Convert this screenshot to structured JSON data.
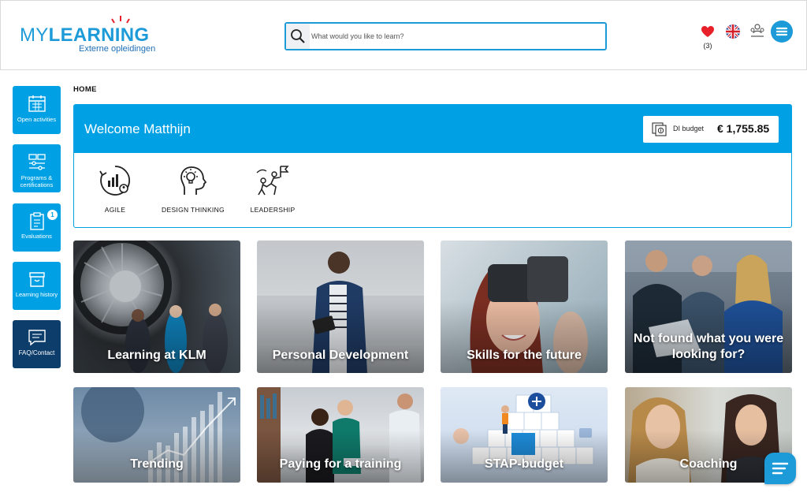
{
  "brand": {
    "name_a": "MY",
    "name_b": "LEARNING",
    "subtitle": "Externe opleidingen"
  },
  "search": {
    "placeholder": "What would you like to learn?"
  },
  "header": {
    "favorites_count": "(3)"
  },
  "sidebar": {
    "items": [
      {
        "label": "Open activities",
        "icon": "calendar-icon"
      },
      {
        "label": "Programs & certifications",
        "icon": "program-icon"
      },
      {
        "label": "Evaluations",
        "icon": "clipboard-icon",
        "badge": "1"
      },
      {
        "label": "Learning history",
        "icon": "archive-box-icon"
      },
      {
        "label": "FAQ/Contact",
        "icon": "chat-bubble-icon"
      }
    ]
  },
  "breadcrumb": "HOME",
  "welcome": {
    "title": "Welcome Matthijn",
    "budget_label": "DI budget",
    "budget_value": "€ 1,755.85"
  },
  "topics": [
    {
      "label": "AGILE",
      "icon": "agile-icon"
    },
    {
      "label": "DESIGN THINKING",
      "icon": "design-thinking-icon"
    },
    {
      "label": "LEADERSHIP",
      "icon": "leadership-icon"
    }
  ],
  "tiles": [
    {
      "label": "Learning at KLM"
    },
    {
      "label": "Personal Development"
    },
    {
      "label": "Skills for the future"
    },
    {
      "label": "Not found what you were looking for?"
    },
    {
      "label": "Trending"
    },
    {
      "label": "Paying for a training"
    },
    {
      "label": "STAP-budget"
    },
    {
      "label": "Coaching"
    }
  ],
  "colors": {
    "accent": "#00a1e4",
    "dark": "#0c3d6b",
    "favorite": "#e8202a"
  }
}
